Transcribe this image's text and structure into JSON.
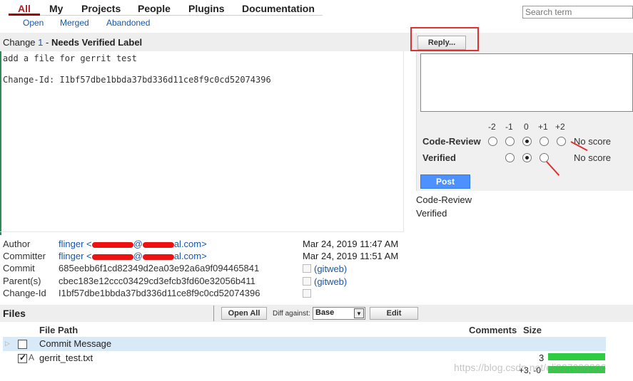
{
  "nav": {
    "tabs": [
      "All",
      "My",
      "Projects",
      "People",
      "Plugins",
      "Documentation"
    ],
    "sub_tabs": [
      "Open",
      "Merged",
      "Abandoned"
    ]
  },
  "search": {
    "placeholder": "Search term"
  },
  "change": {
    "prefix": "Change",
    "number": "1",
    "separator": "-",
    "status": "Needs Verified Label",
    "message_line1": "add a file for gerrit test",
    "message_line2": "Change-Id: I1bf57dbe1bbda37bd336d11ce8f9c0cd52074396"
  },
  "reply": {
    "button_label": "Reply...",
    "score_headers": [
      "-2",
      "-1",
      "0",
      "+1",
      "+2"
    ],
    "labels": [
      {
        "name": "Code-Review",
        "value_text": "No score",
        "selected": "0"
      },
      {
        "name": "Verified",
        "value_text": "No score",
        "selected": "0"
      }
    ],
    "post_label": "Post"
  },
  "approvals": [
    "Code-Review",
    "Verified"
  ],
  "meta": {
    "author_label": "Author",
    "author_name": "flinger <",
    "author_domain": "al.com>",
    "author_at": "@",
    "author_date": "Mar 24, 2019 11:47 AM",
    "committer_label": "Committer",
    "committer_name": "flinger <",
    "committer_domain": "al.com>",
    "committer_at": "@",
    "committer_date": "Mar 24, 2019 11:51 AM",
    "commit_label": "Commit",
    "commit_value": "685eebb6f1cd82349d2ea03e92a6a9f094465841",
    "commit_link": "(gitweb)",
    "parent_label": "Parent(s)",
    "parent_value": "cbec183e12ccc03429cd3efcb3fd60e32056b411",
    "parent_link": "(gitweb)",
    "changeid_label": "Change-Id",
    "changeid_value": "I1bf57dbe1bbda37bd336d11ce8f9c0cd52074396"
  },
  "files": {
    "title": "Files",
    "open_all_label": "Open All",
    "diff_against_label": "Diff against:",
    "diff_against_value": "Base",
    "edit_label": "Edit",
    "col_path": "File Path",
    "col_comments": "Comments",
    "col_size": "Size",
    "rows": [
      {
        "status": "",
        "path": "Commit Message",
        "comments": "",
        "size": ""
      },
      {
        "status": "A",
        "path": "gerrit_test.txt",
        "comments": "3",
        "size": "+3, -0"
      }
    ]
  },
  "watermark": "https://blog.csdn.net/eli927098306",
  "colors": {
    "accent": "#4d90fe",
    "highlight": "#e03030",
    "link": "#1a57a8",
    "size_bar": "#2ecc40"
  }
}
